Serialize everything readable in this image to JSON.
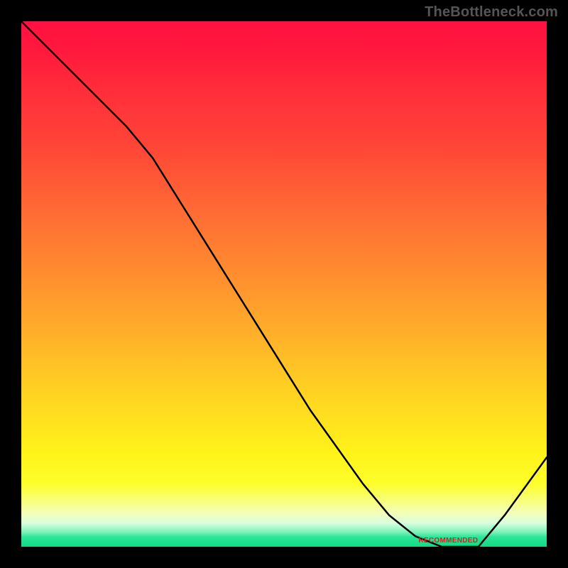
{
  "watermark": "TheBottleneck.com",
  "chart_data": {
    "type": "line",
    "title": "",
    "xlabel": "",
    "ylabel": "",
    "x": [
      0.0,
      0.05,
      0.1,
      0.15,
      0.2,
      0.25,
      0.3,
      0.35,
      0.4,
      0.45,
      0.5,
      0.55,
      0.6,
      0.65,
      0.7,
      0.75,
      0.8,
      0.83,
      0.87,
      0.92,
      1.0
    ],
    "y": [
      1.0,
      0.95,
      0.9,
      0.85,
      0.8,
      0.74,
      0.66,
      0.58,
      0.5,
      0.42,
      0.34,
      0.26,
      0.19,
      0.12,
      0.06,
      0.02,
      0.0,
      0.0,
      0.0,
      0.06,
      0.17
    ],
    "xlim": [
      0,
      1
    ],
    "ylim": [
      0,
      1
    ],
    "series": [
      {
        "name": "bottleneck-curve",
        "x_key": "x",
        "y_key": "y",
        "stroke": "#000000",
        "stroke_width": 2.5
      }
    ],
    "gradient_colors": {
      "top": "#ff1040",
      "mid_upper": "#ff8d2f",
      "mid": "#ffd621",
      "lower": "#fdfe2a",
      "band_pale": "#f4ffb8",
      "band_green": "#1ee08e"
    },
    "annotation": {
      "label": "RECOMMENDED",
      "x": 0.81,
      "y": 0.005
    }
  }
}
